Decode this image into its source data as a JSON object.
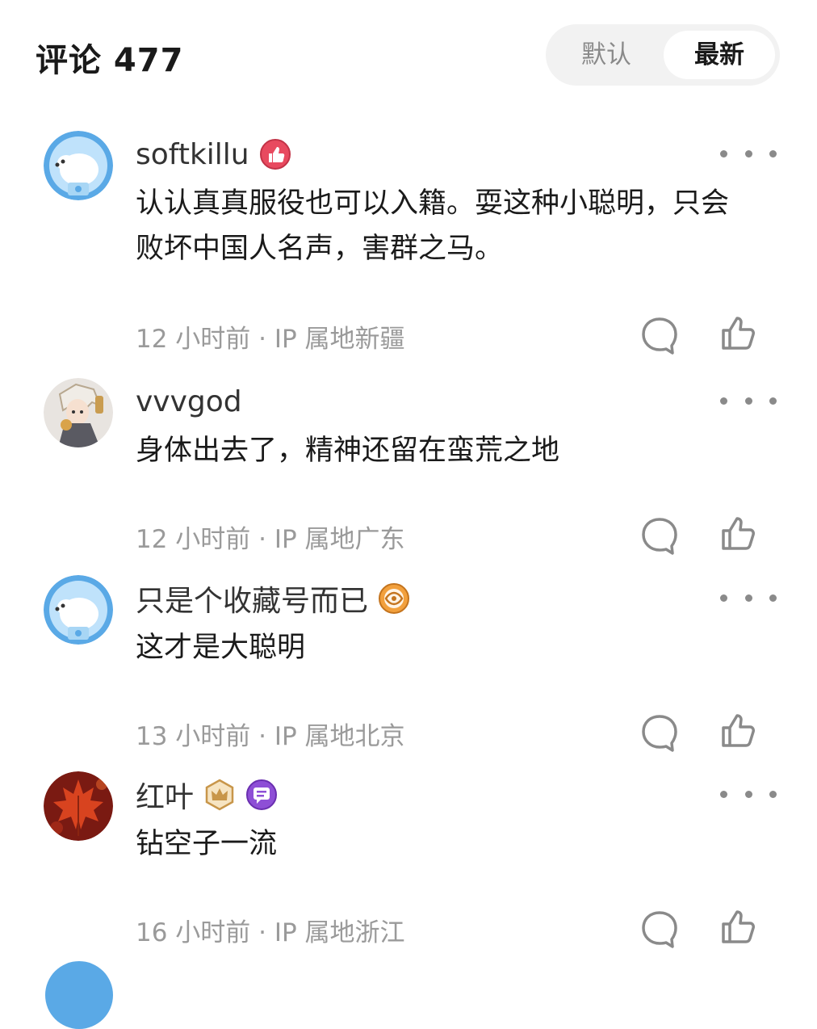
{
  "header": {
    "title": "评论 477",
    "sort": {
      "default_label": "默认",
      "latest_label": "最新",
      "selected": "最新"
    }
  },
  "comments": [
    {
      "username": "softkillu",
      "text": "认认真真服役也可以入籍。耍这种小聪明，只会败坏中国人名声，害群之马。",
      "meta": "12 小时前 · IP 属地新疆",
      "avatar_icon": "polar-bear-avatar",
      "badges": [
        "thumbs-up-badge-icon"
      ]
    },
    {
      "username": "vvvgod",
      "text": "身体出去了，精神还留在蛮荒之地",
      "meta": "12 小时前 · IP 属地广东",
      "avatar_icon": "anime-character-avatar",
      "badges": []
    },
    {
      "username": "只是个收藏号而已",
      "text": "这才是大聪明",
      "meta": "13 小时前 · IP 属地北京",
      "avatar_icon": "polar-bear-avatar",
      "badges": [
        "eye-badge-icon"
      ]
    },
    {
      "username": "红叶",
      "text": "钻空子一流",
      "meta": "16 小时前 · IP 属地浙江",
      "avatar_icon": "red-maple-leaf-avatar",
      "badges": [
        "crown-badge-icon",
        "message-badge-icon"
      ]
    }
  ],
  "colors": {
    "text_primary": "#1a1a1a",
    "text_secondary": "#9a9a9a",
    "toggle_bg": "#f2f2f2",
    "avatar_blue": "#5aa9e6"
  }
}
